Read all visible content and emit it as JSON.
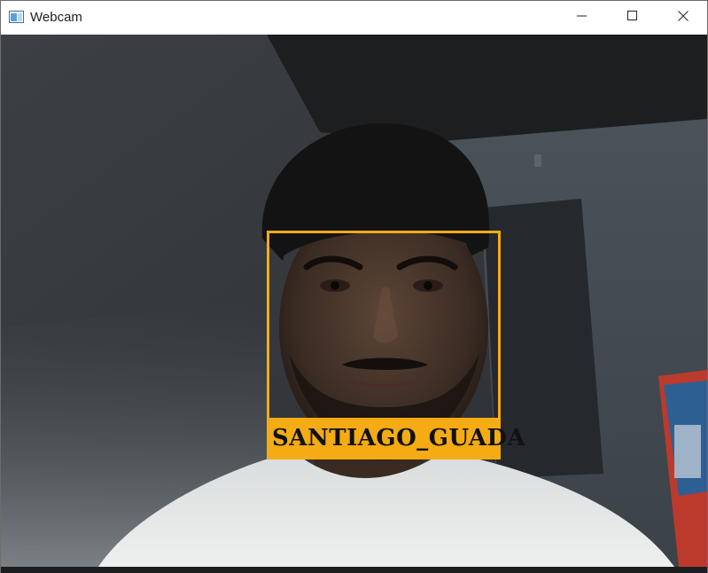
{
  "window": {
    "title": "Webcam",
    "icon": "opencv-window-icon",
    "controls": {
      "minimize_icon": "minimize-icon",
      "maximize_icon": "maximize-icon",
      "close_icon": "close-icon"
    }
  },
  "detection": {
    "label": "SANTIAGO_GUADA",
    "box_color": "#f4ab14",
    "text_color": "#111111"
  }
}
